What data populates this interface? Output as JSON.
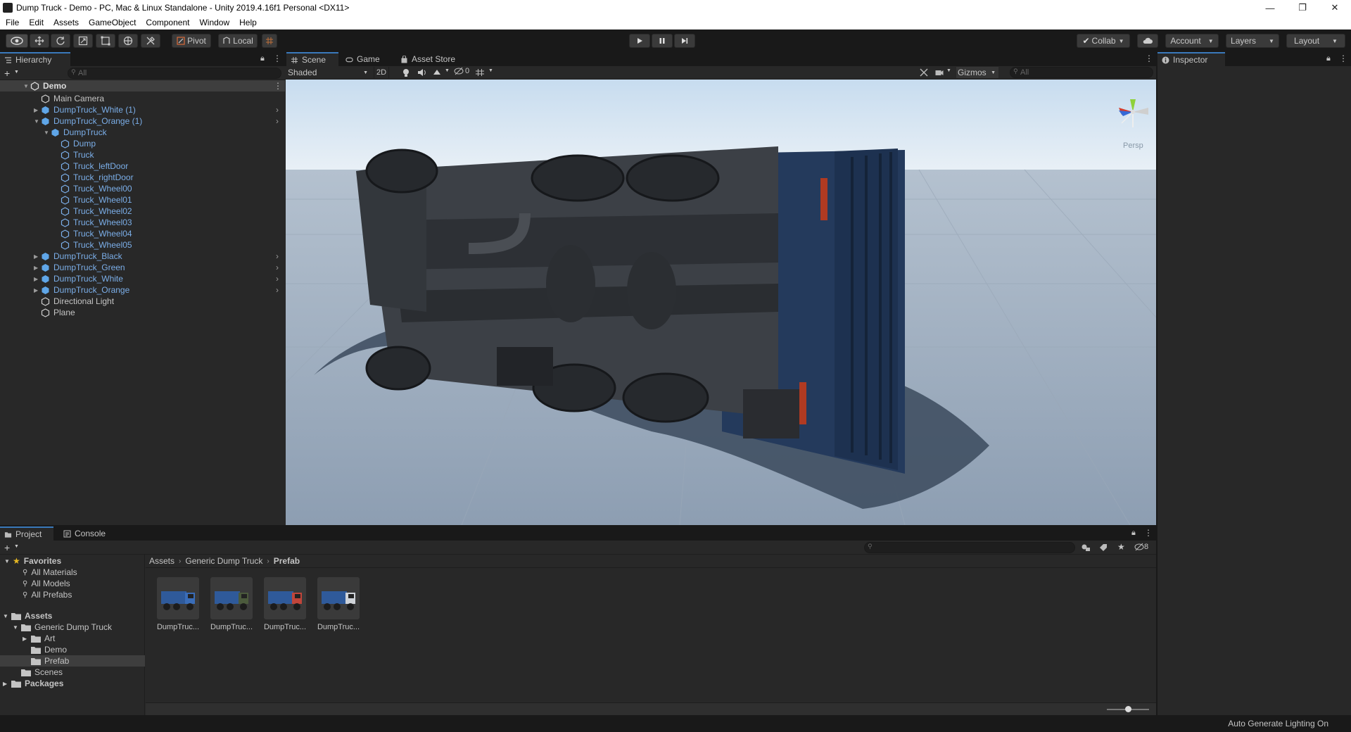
{
  "window": {
    "title": "Dump Truck - Demo - PC, Mac & Linux Standalone - Unity 2019.4.16f1 Personal <DX11>",
    "minimize": "—",
    "restore": "❐",
    "close": "✕"
  },
  "menu": [
    "File",
    "Edit",
    "Assets",
    "GameObject",
    "Component",
    "Window",
    "Help"
  ],
  "toolbar": {
    "pivot": "Pivot",
    "local": "Local",
    "collab": "Collab",
    "account": "Account",
    "layers": "Layers",
    "layout": "Layout"
  },
  "hierarchy": {
    "tab": "Hierarchy",
    "search_placeholder": "All",
    "scene": "Demo",
    "items": [
      {
        "label": "Main Camera"
      },
      {
        "label": "DumpTruck_White (1)"
      },
      {
        "label": "DumpTruck_Orange (1)"
      },
      {
        "label": "DumpTruck"
      },
      {
        "label": "Dump"
      },
      {
        "label": "Truck"
      },
      {
        "label": "Truck_leftDoor"
      },
      {
        "label": "Truck_rightDoor"
      },
      {
        "label": "Truck_Wheel00"
      },
      {
        "label": "Truck_Wheel01"
      },
      {
        "label": "Truck_Wheel02"
      },
      {
        "label": "Truck_Wheel03"
      },
      {
        "label": "Truck_Wheel04"
      },
      {
        "label": "Truck_Wheel05"
      },
      {
        "label": "DumpTruck_Black"
      },
      {
        "label": "DumpTruck_Green"
      },
      {
        "label": "DumpTruck_White"
      },
      {
        "label": "DumpTruck_Orange"
      },
      {
        "label": "Directional Light"
      },
      {
        "label": "Plane"
      }
    ]
  },
  "scene": {
    "tabs": [
      "Scene",
      "Game",
      "Asset Store"
    ],
    "shading": "Shaded",
    "mode_2d": "2D",
    "hidden_count": "0",
    "gizmos": "Gizmos",
    "search_placeholder": "All",
    "projection": "Persp"
  },
  "inspector": {
    "tab": "Inspector"
  },
  "project": {
    "tabs": [
      "Project",
      "Console"
    ],
    "favorites": "Favorites",
    "favorite_items": [
      "All Materials",
      "All Models",
      "All Prefabs"
    ],
    "assets": "Assets",
    "generic_dump_truck": "Generic Dump Truck",
    "subfolders": [
      "Art",
      "Demo",
      "Prefab"
    ],
    "scenes": "Scenes",
    "packages": "Packages",
    "breadcrumb": [
      "Assets",
      "Generic Dump Truck",
      "Prefab"
    ],
    "badge_count": "8",
    "tiles": [
      {
        "label": "DumpTruc...",
        "cab": "#3a6db8"
      },
      {
        "label": "DumpTruc...",
        "cab": "#4b5a3c"
      },
      {
        "label": "DumpTruc...",
        "cab": "#c0453a"
      },
      {
        "label": "DumpTruc...",
        "cab": "#cfd3d8"
      }
    ]
  },
  "status": {
    "lighting": "Auto Generate Lighting On"
  }
}
